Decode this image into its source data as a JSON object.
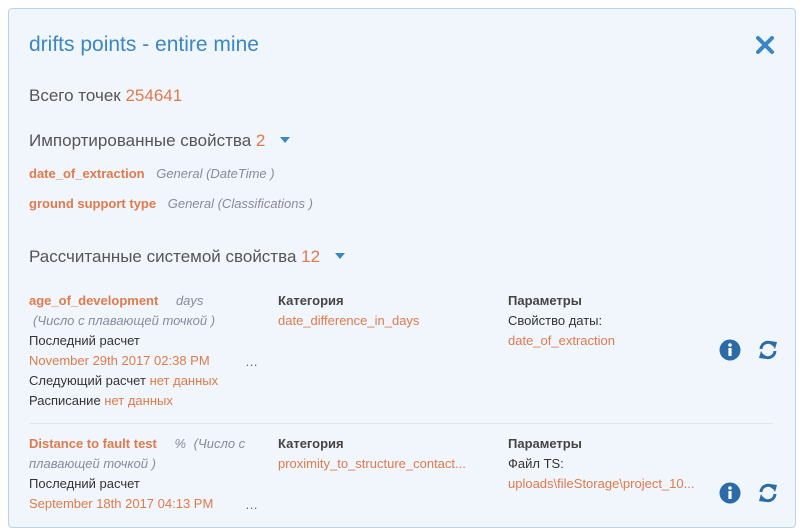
{
  "header": {
    "title": "drifts points - entire mine"
  },
  "summary": {
    "total_label": "Всего точек",
    "total_value": "254641"
  },
  "imported": {
    "label": "Импортированные свойства",
    "count": "2",
    "items": [
      {
        "name": "date_of_extraction",
        "type": "General (DateTime )"
      },
      {
        "name": "ground support type",
        "type": "General (Classifications )"
      }
    ]
  },
  "computed": {
    "label": "Рассчитанные системой свойства",
    "count": "12",
    "column_category": "Категория",
    "column_params": "Параметры",
    "last_calc_label": "Последний расчет",
    "next_calc_label": "Следующий расчет",
    "schedule_label": "Расписание",
    "items": [
      {
        "name": "age_of_development",
        "unit": "days",
        "type": "(Число с плавающей точкой )",
        "last_calc": "November 29th 2017 02:38 PM",
        "next_calc": "нет данных",
        "schedule": "нет данных",
        "category": "date_difference_in_days",
        "param_label": "Свойство даты:",
        "param_value": "date_of_extraction"
      },
      {
        "name": "Distance to fault test",
        "unit": "%",
        "type_part1": "(Число с",
        "type_part2": "плавающей точкой )",
        "last_calc": "September 18th 2017 04:13 PM",
        "category": "proximity_to_structure_contact...",
        "param_label": "Файл TS:",
        "param_value": "uploads\\fileStorage\\project_10..."
      }
    ]
  },
  "ellipsis": "…",
  "colors": {
    "accent": "#3b87c4",
    "highlight": "#e07a4c",
    "panel_bg": "#f0f6fb"
  },
  "icons": {
    "close": "close-icon",
    "info": "info-icon",
    "refresh": "refresh-icon"
  }
}
